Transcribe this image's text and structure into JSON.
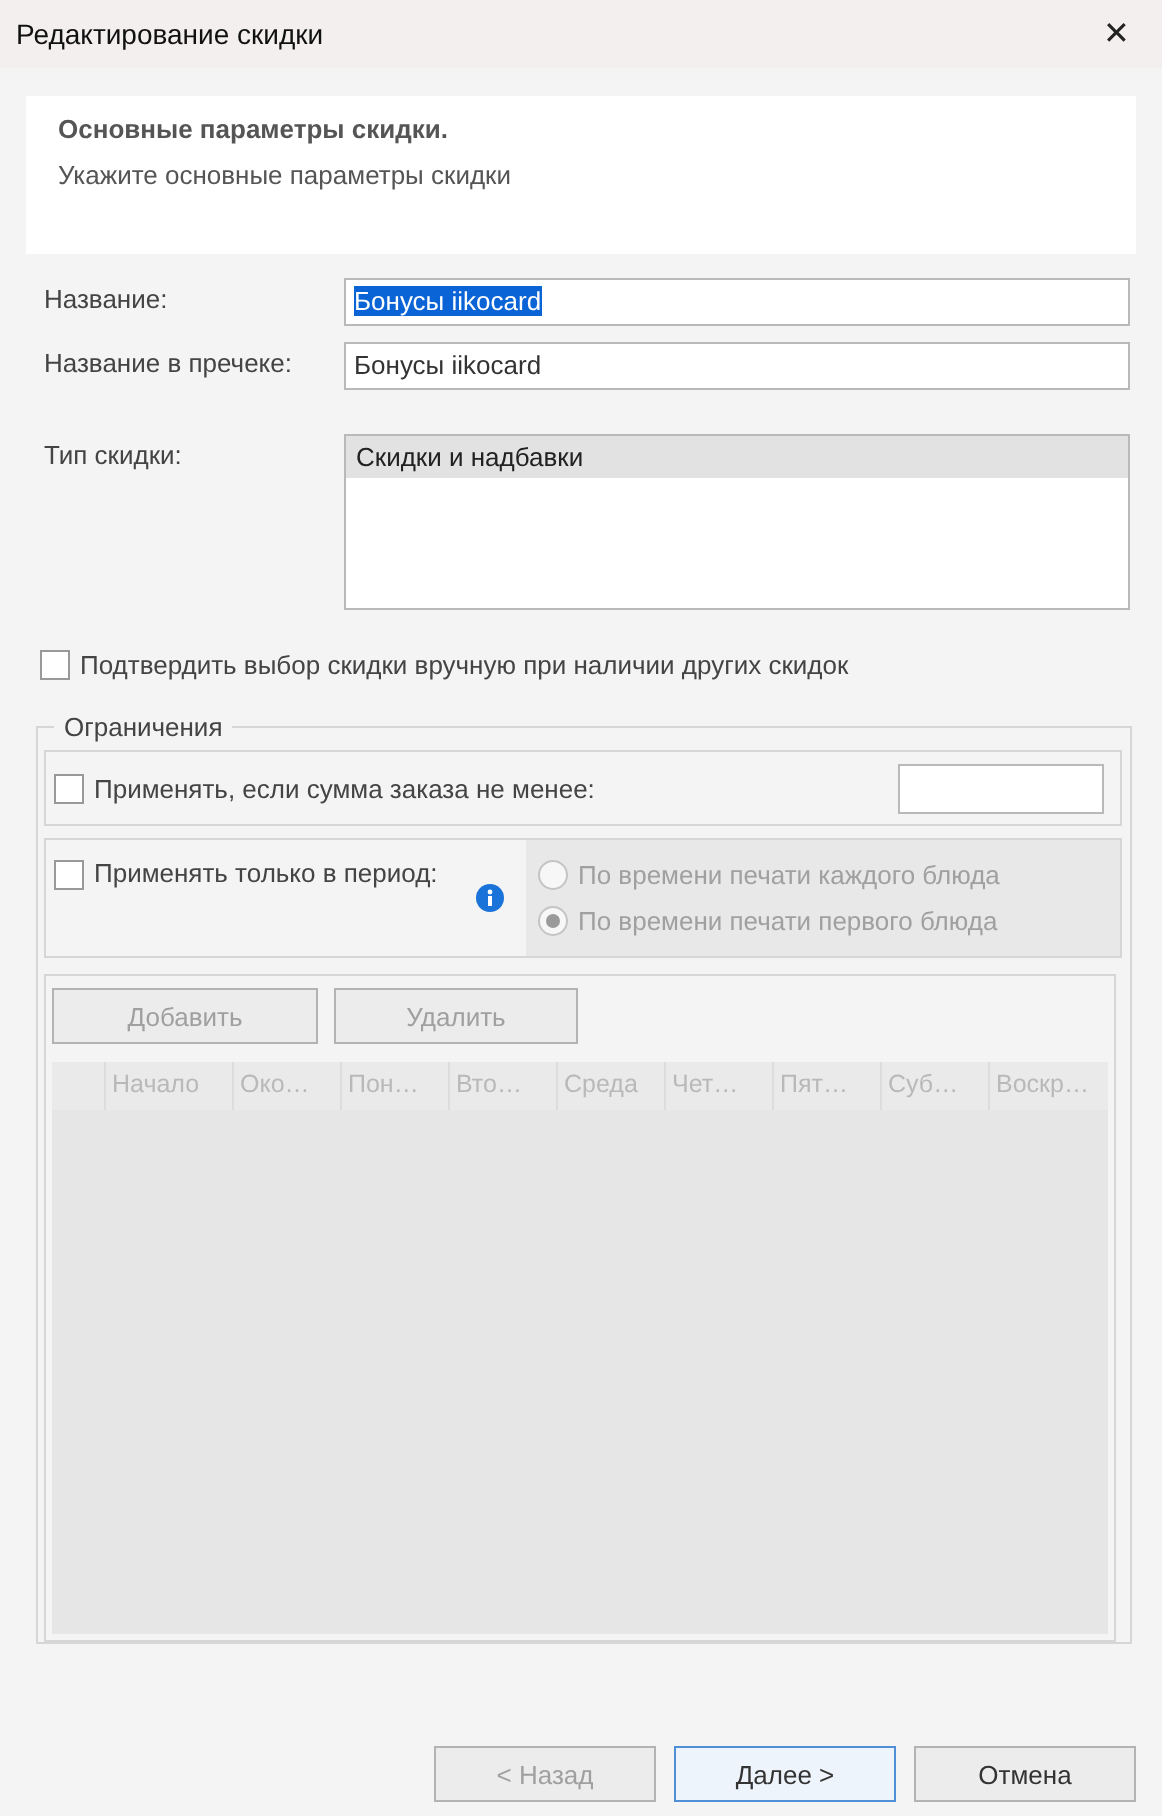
{
  "window": {
    "title": "Редактирование скидки",
    "close": "✕"
  },
  "header": {
    "title": "Основные параметры скидки.",
    "subtitle": "Укажите основные параметры скидки"
  },
  "fields": [
    {
      "label": "Название:",
      "value": "Бонусы iikocard",
      "text_selected": true
    },
    {
      "label": "Название в пречеке:",
      "value": "Бонусы iikocard",
      "text_selected": false
    }
  ],
  "discount_type": {
    "label": "Тип скидки:",
    "items": [
      {
        "label": "Скидки и надбавки",
        "selected": true
      }
    ]
  },
  "confirm": {
    "label": "Подтвердить выбор скидки вручную при наличии других скидок",
    "checked": false
  },
  "restrictions": {
    "title": "Ограничения",
    "min_sum": {
      "label": "Применять, если сумма заказа не менее:",
      "checked": false
    },
    "period": {
      "label": "Применять только в период:",
      "checked": false,
      "options": [
        {
          "label": "По времени печати каждого блюда",
          "selected": false,
          "disabled": true
        },
        {
          "label": "По времени печати первого блюда",
          "selected": true,
          "disabled": true
        }
      ]
    },
    "buttons": [
      {
        "label": "Добавить",
        "disabled": true
      },
      {
        "label": "Удалить",
        "disabled": true
      }
    ],
    "columns": [
      "Начало",
      "Око…",
      "Пон…",
      "Вто…",
      "Среда",
      "Чет…",
      "Пят…",
      "Суб…",
      "Воскр…"
    ]
  },
  "footer": [
    {
      "label": "< Назад",
      "disabled": true,
      "focused": false
    },
    {
      "label": "Далее >",
      "disabled": false,
      "focused": true
    },
    {
      "label": "Отмена",
      "disabled": false,
      "focused": false
    }
  ]
}
